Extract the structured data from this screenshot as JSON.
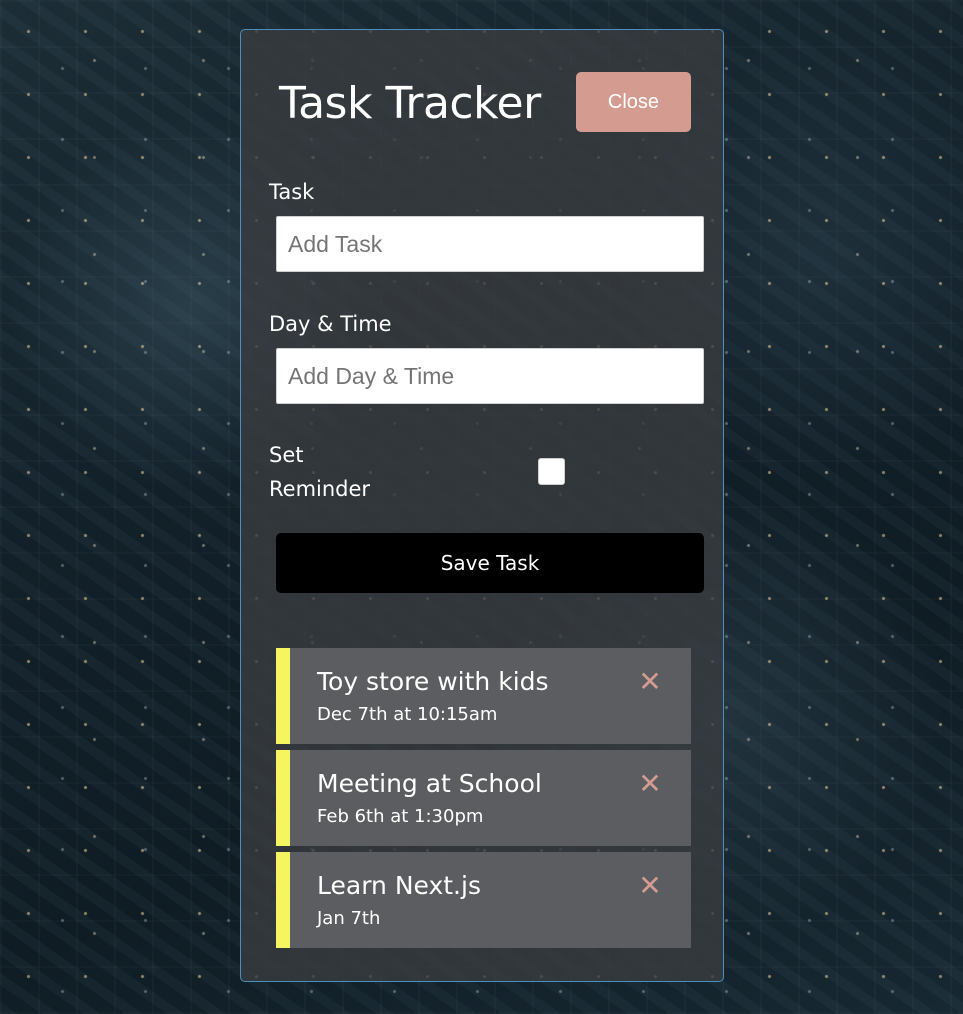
{
  "app": {
    "title": "Task Tracker",
    "close_label": "Close",
    "accent_close": "#d49b91",
    "reminder_color": "#f5f562"
  },
  "form": {
    "task_label": "Task",
    "task_placeholder": "Add Task",
    "task_value": "",
    "day_label": "Day & Time",
    "day_placeholder": "Add Day & Time",
    "day_value": "",
    "reminder_label_line1": "Set",
    "reminder_label_line2": "Reminder",
    "reminder_checked": false,
    "save_label": "Save Task"
  },
  "tasks": [
    {
      "text": "Toy store with kids",
      "day": "Dec 7th at 10:15am",
      "reminder": true,
      "delete_icon": "times-icon"
    },
    {
      "text": "Meeting at School",
      "day": "Feb 6th at 1:30pm",
      "reminder": true,
      "delete_icon": "times-icon"
    },
    {
      "text": "Learn Next.js",
      "day": "Jan 7th",
      "reminder": true,
      "delete_icon": "times-icon"
    }
  ]
}
